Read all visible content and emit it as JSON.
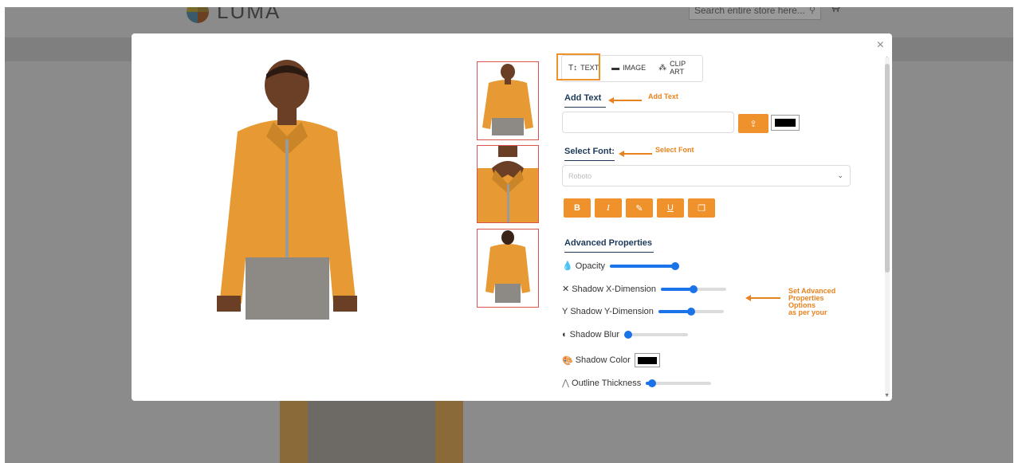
{
  "store": {
    "logo_text": "LUMA",
    "search_placeholder": "Search entire store here..."
  },
  "modal": {
    "close_glyph": "×"
  },
  "tabs": [
    {
      "label": "TEXT",
      "icon": "text-format-icon"
    },
    {
      "label": "IMAGE",
      "icon": "image-icon"
    },
    {
      "label": "CLIP ART",
      "icon": "clip-art-icon"
    }
  ],
  "add_text": {
    "title": "Add Text",
    "annotation": "Add Text",
    "input_value": "",
    "text_color": "#000000"
  },
  "select_font": {
    "title": "Select Font:",
    "annotation": "Select Font",
    "selected": "Roboto"
  },
  "style_buttons": [
    {
      "label": "B",
      "name": "bold-button"
    },
    {
      "label": "I",
      "name": "italic-button"
    },
    {
      "label": "✎",
      "name": "text-color-button"
    },
    {
      "label": "U",
      "name": "underline-button"
    },
    {
      "label": "❐",
      "name": "duplicate-button"
    }
  ],
  "advanced": {
    "title": "Advanced Properties",
    "annotation_lines": [
      "Set Advanced",
      "Properties",
      "Options",
      "as per your"
    ],
    "opacity_label": "Opacity",
    "opacity_value": 1.0,
    "shadow_x_label": "Shadow X-Dimension",
    "shadow_x_value": 0.5,
    "shadow_y_label": "Shadow Y-Dimension",
    "shadow_y_value": 0.5,
    "shadow_blur_label": "Shadow Blur",
    "shadow_blur_value": 0.0,
    "shadow_color_label": "Shadow Color",
    "shadow_color": "#000000",
    "outline_label": "Outline Thickness",
    "outline_value": 0.1
  },
  "colors": {
    "accent": "#f0922b",
    "slider": "#1a73e8",
    "title": "#1d3a5a",
    "annotation": "#e8821e",
    "shirt": "#e79a34"
  }
}
